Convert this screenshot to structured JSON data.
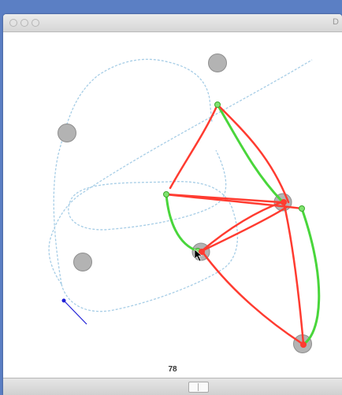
{
  "window": {
    "title": "D"
  },
  "canvas": {
    "frame_number": "78"
  },
  "colors": {
    "path": "#a6cde6",
    "edge_red": "#ff3b30",
    "edge_green": "#49d63b",
    "node_gray": "#b3b3b3",
    "heading": "#1f1fd6"
  },
  "icons": {
    "pointer": "arrow-cursor-icon"
  }
}
